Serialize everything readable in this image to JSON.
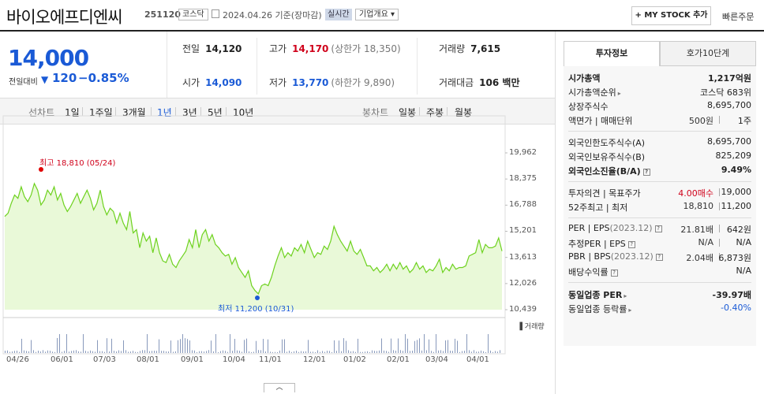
{
  "header": {
    "title": "바이오에프디엔씨",
    "code": "251120",
    "market": "코스닥",
    "date": "2024.04.26  기준(장마감)",
    "realtime": "실시간",
    "overview": "기업개요 ▾",
    "mystock": "+ MY STOCK 추가",
    "quickorder": "빠른주문"
  },
  "quote": {
    "price": "14,000",
    "change_label": "전일대비",
    "change_arrow": "▼",
    "change": "120",
    "change_pct": "−0.85%",
    "stats": {
      "prev_label": "전일",
      "prev": "14,120",
      "high_label": "고가",
      "high": "14,170",
      "upper_limit": "(상한가 18,350)",
      "volume_label": "거래량",
      "volume": "7,615",
      "open_label": "시가",
      "open": "14,090",
      "low_label": "저가",
      "low": "13,770",
      "lower_limit": "(하한가 9,890)",
      "amount_label": "거래대금",
      "amount": "106 백만"
    }
  },
  "periods": {
    "line_chart": "선차트",
    "p1d": "1일",
    "p1w": "1주일",
    "p3m": "3개월",
    "p1y": "1년",
    "p3y": "3년",
    "p5y": "5년",
    "p10y": "10년",
    "candle": "봉차트",
    "daily": "일봉",
    "weekly": "주봉",
    "monthly": "월봉",
    "selected": "1년"
  },
  "chart_data": {
    "type": "area",
    "yticks": [
      "19,962",
      "18,375",
      "16,788",
      "15,201",
      "13,613",
      "12,026",
      "10,439"
    ],
    "ylim": [
      10439,
      19962
    ],
    "xticks": [
      "04/26",
      "06/01",
      "07/03",
      "08/01",
      "09/01",
      "10/04",
      "11/01",
      "12/01",
      "01/02",
      "02/01",
      "03/04",
      "04/01"
    ],
    "high_annotation": "최고 18,810 (05/24)",
    "low_annotation": "최저 11,200 (10/31)",
    "volume_legend": "거래량",
    "values": [
      16100,
      16300,
      16900,
      17400,
      17200,
      17900,
      17300,
      17000,
      17400,
      18100,
      17700,
      16800,
      17100,
      17700,
      17400,
      17900,
      17100,
      17500,
      16800,
      16400,
      16700,
      17100,
      17500,
      16900,
      17300,
      17700,
      17200,
      16500,
      16900,
      17700,
      16700,
      16200,
      16600,
      16400,
      15700,
      16300,
      15700,
      15300,
      16400,
      15100,
      15300,
      14200,
      15100,
      14600,
      14900,
      13900,
      14800,
      13900,
      13400,
      13300,
      13800,
      13200,
      13000,
      13400,
      13700,
      14000,
      14700,
      14200,
      15300,
      14200,
      15000,
      15300,
      14600,
      15000,
      14400,
      14200,
      13900,
      13700,
      13800,
      13200,
      13600,
      13000,
      12700,
      12400,
      12800,
      11900,
      11600,
      11400,
      11900,
      12000,
      11900,
      12400,
      13100,
      13700,
      14200,
      13600,
      13900,
      13700,
      14200,
      14000,
      14400,
      13900,
      14600,
      14100,
      13600,
      13900,
      13800,
      14300,
      14100,
      14600,
      15500,
      15000,
      14600,
      14300,
      14000,
      14600,
      14000,
      13800,
      14100,
      13600,
      13100,
      13100,
      12800,
      13000,
      12700,
      12900,
      13200,
      12800,
      13200,
      12900,
      13300,
      12900,
      13100,
      12700,
      12900,
      13300,
      12900,
      13100,
      12700,
      12900,
      12800,
      13100,
      13500,
      12700,
      13000,
      12800,
      13200,
      12900,
      13000,
      13000,
      13100,
      13700,
      13800,
      13900,
      14700,
      13900,
      14400,
      14200,
      14200,
      14300,
      14800,
      14000
    ]
  },
  "sidebar": {
    "tab_invest": "투자정보",
    "tab_hoga": "호가10단계",
    "market_cap_label": "시가총액",
    "market_cap": "1,217억원",
    "rank_label": "시가총액순위",
    "rank": "코스닥 683위",
    "shares_label": "상장주식수",
    "shares": "8,695,700",
    "par_label": "액면가 | 매매단위",
    "par": "500원",
    "par_unit": "1주",
    "foreign_limit_label": "외국인한도주식수(A)",
    "foreign_limit": "8,695,700",
    "foreign_hold_label": "외국인보유주식수(B)",
    "foreign_hold": "825,209",
    "foreign_ratio_label": "외국인소진율(B/A)",
    "foreign_ratio": "9.49%",
    "opinion_label": "투자의견 | 목표주가",
    "opinion": "4.00매수",
    "target": "19,000",
    "w52_label": "52주최고 | 최저",
    "w52_high": "18,810",
    "w52_low": "11,200",
    "per_label": "PER | EPS",
    "per_period": "(2023.12)",
    "per": "21.81배",
    "eps": "642원",
    "est_label": "추정PER | EPS",
    "est_per": "N/A",
    "est_eps": "N/A",
    "pbr_label": "PBR | BPS",
    "pbr_period": "(2023.12)",
    "pbr": "2.04배",
    "bps": "6,873원",
    "div_label": "배당수익률",
    "div": "N/A",
    "ind_per_label": "동일업종 PER",
    "ind_per": "-39.97배",
    "ind_rate_label": "동일업종 등락률",
    "ind_rate": "-0.40%"
  },
  "colors": {
    "blue": "#1a5ad6",
    "red": "#d0021b",
    "line": "#6ed21f",
    "fill": "#e9f9d8",
    "hi_dot": "#e00000",
    "lo_dot": "#1a5ad6"
  }
}
